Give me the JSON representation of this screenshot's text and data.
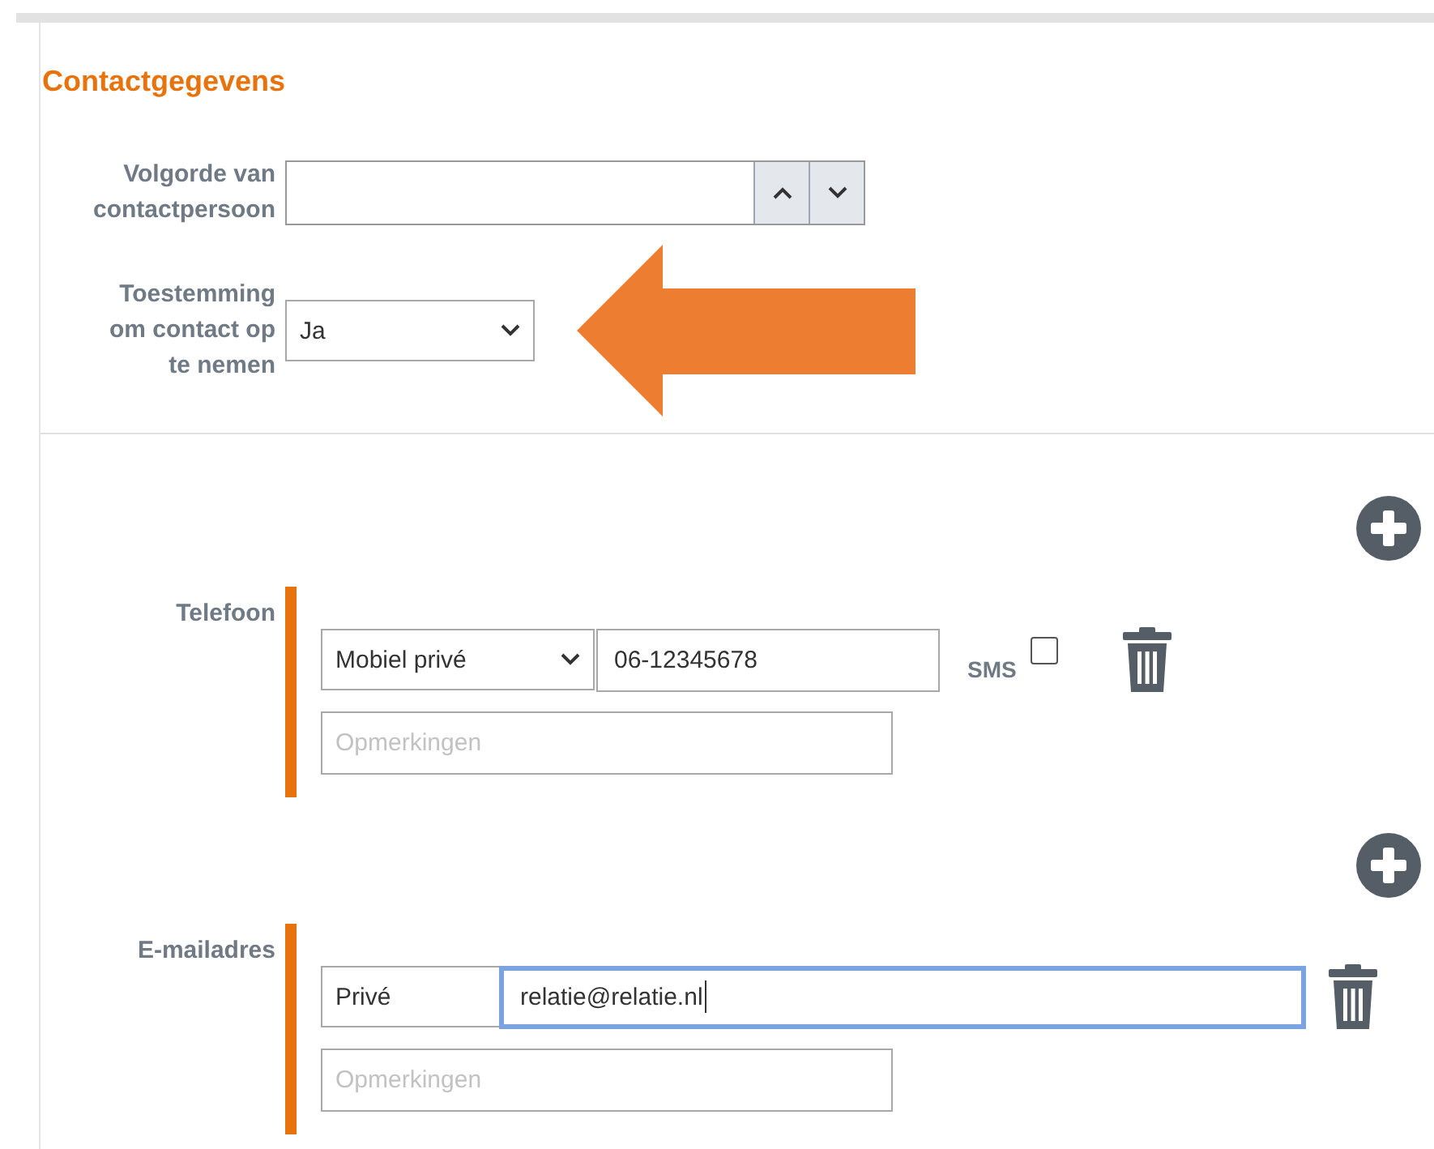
{
  "section_title": "Contactgegevens",
  "fields": [
    {
      "kind": "spinner",
      "label": "Volgorde van contactpersoon"
    },
    {
      "kind": "select",
      "label": "Toestemming om contact op te nemen",
      "value": "Ja",
      "callout_arrow": true
    }
  ],
  "groups": [
    {
      "kind": "phone",
      "label": "Telefoon",
      "type": "Mobiel privé",
      "value": "06-12345678",
      "focused": false,
      "sms": {
        "label": "SMS",
        "checked": false
      },
      "remarks_placeholder": "Opmerkingen"
    },
    {
      "kind": "email",
      "label": "E-mailadres",
      "type": "Privé",
      "value": "relatie@relatie.nl",
      "focused": true,
      "remarks_placeholder": "Opmerkingen"
    }
  ]
}
